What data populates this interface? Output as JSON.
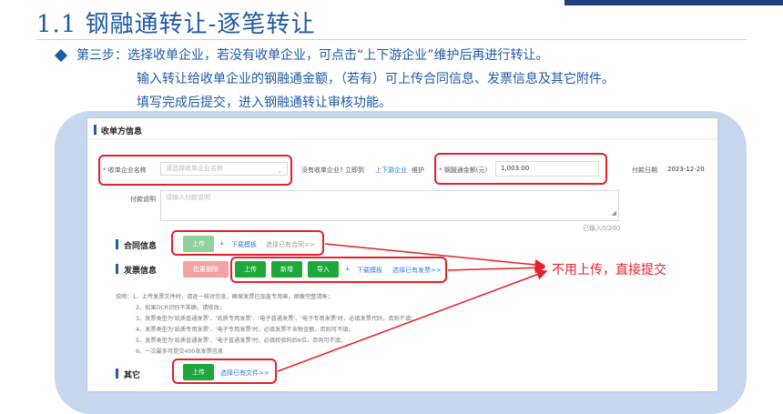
{
  "slide": {
    "title": "1.1  钢融通转让-逐笔转让",
    "step_line1": "第三步：选择收单企业，若没有收单企业，可点击“上下游企业”维护后再进行转让。",
    "step_line2": "输入转让给收单企业的钢融通金额，（若有）可上传合同信息、发票信息及其它附件。",
    "step_line3": "填写完成后提交，进入钢融通转让审核功能。"
  },
  "form": {
    "section_receiver": "收单方信息",
    "company_label_req": "*",
    "company_label": "收单企业名称",
    "company_placeholder": "请选择收单企业名称",
    "no_company_text": "没有收单企业? 立即到",
    "upstream_link": "上下游企业",
    "maintain_text": "维护",
    "amount_label_req": "*",
    "amount_label": "钢融通金额(元)",
    "amount_value": "1,003.00",
    "pay_date_label": "付款日期",
    "pay_date_value": "2023-12-20",
    "pay_note_label": "付款说明",
    "pay_note_placeholder": "请输入付款说明",
    "char_count": "已输入0/200"
  },
  "contract": {
    "title": "合同信息",
    "upload_btn": "上传",
    "download_link": "下载模板",
    "select_existing": "选择已有合同>>"
  },
  "invoice": {
    "title": "发票信息",
    "batch_delete_btn": "批量删除",
    "upload_btn": "上传",
    "add_btn": "新增",
    "import_btn": "导入",
    "download_link": "下载模板",
    "select_existing": "选择已有发票>>"
  },
  "notes": [
    "说明：1、上传发票文件时，请逐一核对信息，确保发票已加盖专用章，图像完整清晰；",
    "2、如果OCR识别不准确，请修改；",
    "3、发票类型为'纸质普通发票'、'纸质专用发票'、'电子普通发票'、'电子专用发票'时，必填发票代码，否则不填；",
    "4、发票类型为'纸质专用发票'、'电子专用发票'时，必填发票不含税金额，否则可不填；",
    "5、发票类型为'纸质普通发票'、'电子普通发票'时，必填校验码后6位，否则可不填；",
    "6、一次最多可提交400张发票信息"
  ],
  "other": {
    "title": "其它",
    "upload_btn": "上传",
    "select_existing": "选择已有文件>>"
  },
  "annotation": "不用上传，直接提交",
  "colors": {
    "title_blue": "#1f5aa8",
    "accent_red": "#e8202a",
    "button_green": "#1ea83c",
    "frame_blue": "#c7d7ee"
  },
  "icons": [
    "diamond-bullet-icon",
    "chevron-down-icon",
    "download-icon",
    "resize-handle-icon",
    "arrow-icon"
  ]
}
